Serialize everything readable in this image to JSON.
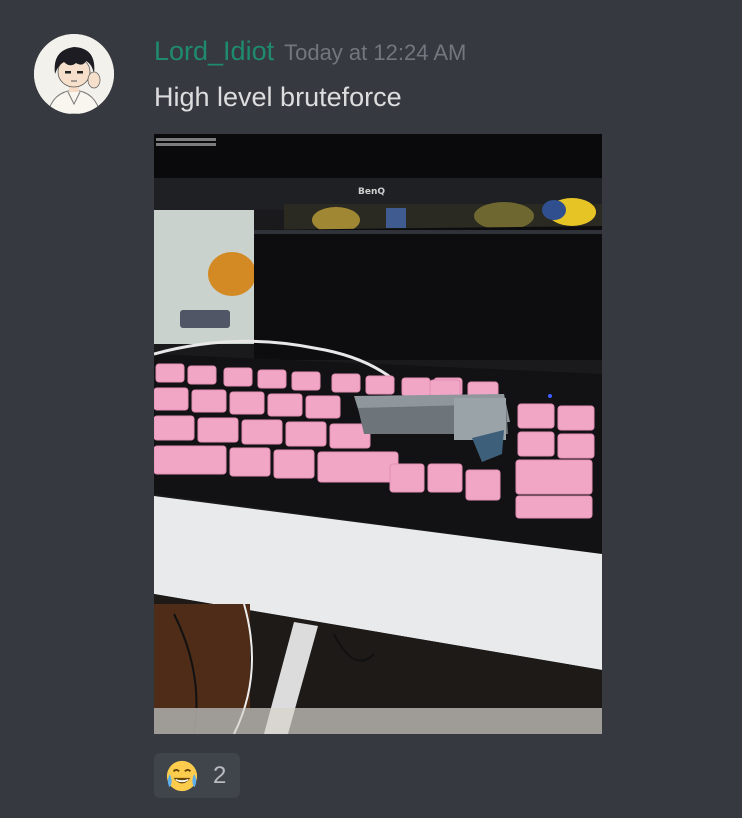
{
  "message": {
    "author": {
      "username": "Lord_Idiot",
      "avatar_icon": "anime-avatar-icon",
      "name_color": "#1f8b6e"
    },
    "timestamp": "Today at 12:24 AM",
    "content": "High level bruteforce",
    "attachment": {
      "kind": "photo",
      "subject": "pink keycap keyboard with stapler pressing keys in front of monitor",
      "monitor_brand": "BenQ"
    },
    "reactions": [
      {
        "emoji_icon": "joy-emoji-icon",
        "count": "2"
      }
    ]
  },
  "colors": {
    "background": "#36393f",
    "text": "#dcddde",
    "timestamp": "#72767d",
    "reaction_bg": "#40444b",
    "reaction_count": "#b9bbbe"
  }
}
